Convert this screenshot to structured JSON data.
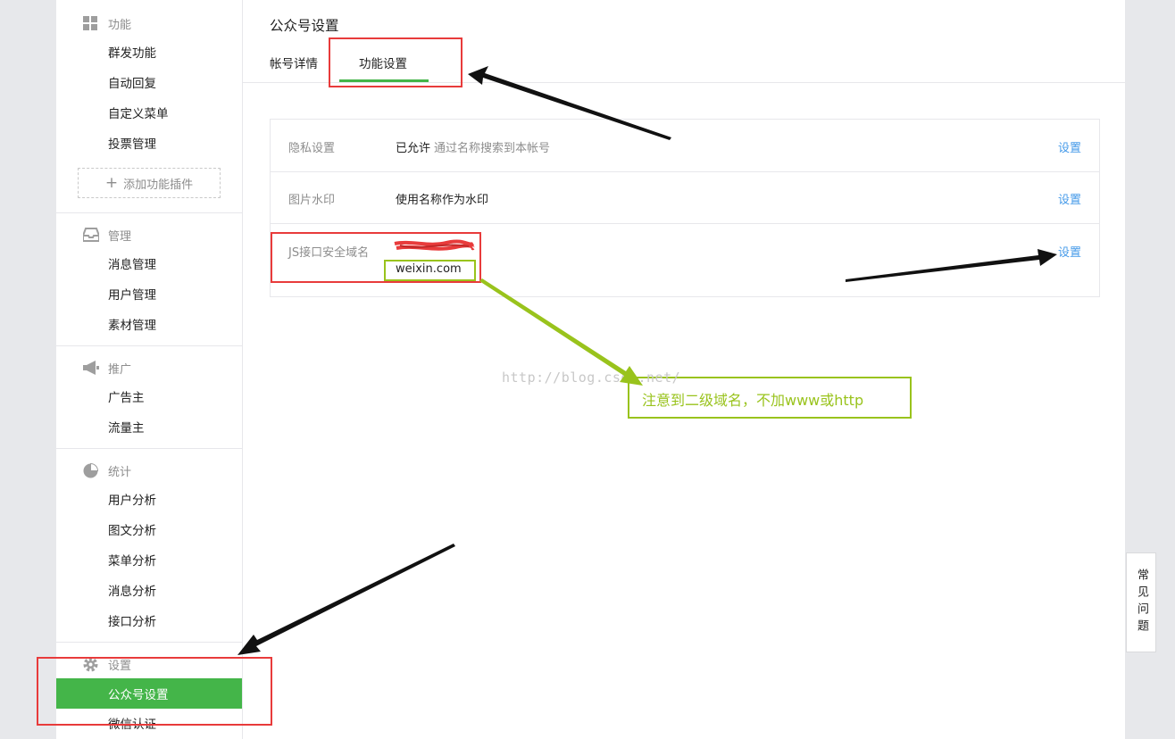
{
  "sidebar": {
    "sections": {
      "func": {
        "title": "功能",
        "icon": "grid-icon"
      },
      "manage": {
        "title": "管理",
        "icon": "inbox-icon"
      },
      "promo": {
        "title": "推广",
        "icon": "megaphone-icon"
      },
      "stats": {
        "title": "统计",
        "icon": "pie-chart-icon"
      },
      "settings": {
        "title": "设置",
        "icon": "gear-icon"
      }
    },
    "items": {
      "mass_send": "群发功能",
      "auto_reply": "自动回复",
      "custom_menu": "自定义菜单",
      "vote": "投票管理",
      "add_plugin": "添加功能插件",
      "messages": "消息管理",
      "users": "用户管理",
      "materials": "素材管理",
      "advertiser": "广告主",
      "traffic": "流量主",
      "user_analysis": "用户分析",
      "article_analysis": "图文分析",
      "menu_analysis": "菜单分析",
      "message_analysis": "消息分析",
      "api_analysis": "接口分析",
      "account_settings": "公众号设置",
      "wechat_verify": "微信认证"
    }
  },
  "main": {
    "title": "公众号设置",
    "tabs": {
      "account_details": "帐号详情",
      "function_settings": "功能设置"
    },
    "rows": {
      "privacy": {
        "label": "隐私设置",
        "value": "已允许",
        "note": "通过名称搜索到本帐号",
        "action": "设置"
      },
      "watermark": {
        "label": "图片水印",
        "value": "使用名称作为水印",
        "action": "设置"
      },
      "js_domain": {
        "label": "JS接口安全域名",
        "value": "weixin.com",
        "action": "设置"
      }
    }
  },
  "help_tab": "常见问题",
  "annotation": {
    "note": "注意到二级域名，不加www或http"
  },
  "watermark_text": "http://blog.csdn.net/",
  "colors": {
    "accent": "#44b549",
    "link": "#459ae9",
    "highlight_red": "#e83b3b",
    "highlight_green": "#99c31c"
  }
}
